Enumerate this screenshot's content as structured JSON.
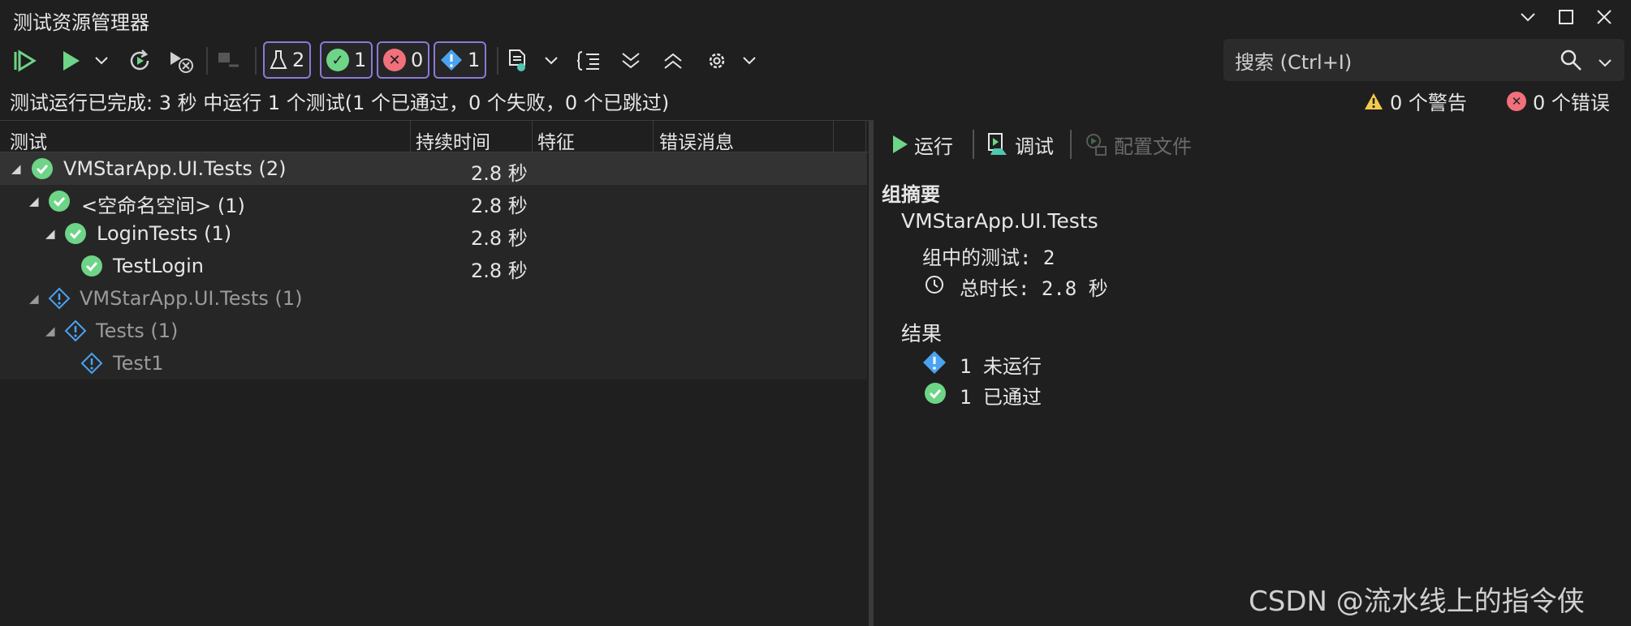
{
  "window": {
    "title": "测试资源管理器"
  },
  "toolbar": {
    "pill_tests_count": "2",
    "pill_passed_count": "1",
    "pill_failed_count": "0",
    "pill_notrun_count": "1",
    "search_placeholder": "搜索 (Ctrl+I)"
  },
  "status": {
    "summary": "测试运行已完成: 3 秒 中运行 1 个测试(1 个已通过，0 个失败，0 个已跳过)",
    "warnings": "0 个警告",
    "errors": "0 个错误"
  },
  "columns": {
    "test": "测试",
    "duration": "持续时间",
    "traits": "特征",
    "error": "错误消息"
  },
  "tree": [
    {
      "name": "VMStarApp.UI.Tests  (2)",
      "duration": "2.8 秒"
    },
    {
      "name": "<空命名空间>  (1)",
      "duration": "2.8 秒"
    },
    {
      "name": "LoginTests  (1)",
      "duration": "2.8 秒"
    },
    {
      "name": "TestLogin",
      "duration": "2.8 秒"
    },
    {
      "name": "VMStarApp.UI.Tests  (1)",
      "duration": ""
    },
    {
      "name": "Tests  (1)",
      "duration": ""
    },
    {
      "name": "Test1",
      "duration": ""
    }
  ],
  "detail": {
    "run_label": "运行",
    "debug_label": "调试",
    "profile_label": "配置文件",
    "group_summary_title": "组摘要",
    "group_name": "VMStarApp.UI.Tests",
    "tests_in_group": "组中的测试: 2",
    "total_duration": "总时长: 2.8 秒",
    "results_title": "结果",
    "results": [
      {
        "text": "1  未运行"
      },
      {
        "text": "1  已通过"
      }
    ]
  },
  "watermark": "CSDN @流水线上的指令侠",
  "colors": {
    "passed": "#6ed487",
    "failed": "#f1707b",
    "notrun": "#4aa3f0",
    "pill_border": "#8a7ad8"
  }
}
